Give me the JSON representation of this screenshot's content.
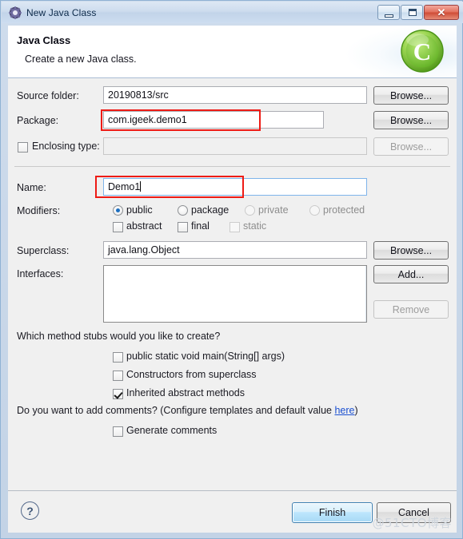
{
  "window": {
    "title": "New Java Class",
    "icon": "gear-icon",
    "controls": {
      "minimize": "─",
      "maximize": "□",
      "close": "✕"
    }
  },
  "header": {
    "title": "Java Class",
    "subtitle": "Create a new Java class.",
    "logo_letter": "C"
  },
  "form": {
    "source_folder": {
      "label": "Source folder:",
      "value": "20190813/src",
      "browse": "Browse..."
    },
    "package": {
      "label": "Package:",
      "value": "com.igeek.demo1",
      "browse": "Browse..."
    },
    "enclosing_type": {
      "label": "Enclosing type:",
      "value": "",
      "browse": "Browse...",
      "checked": false
    },
    "name": {
      "label": "Name:",
      "value": "Demo1"
    },
    "modifiers": {
      "label": "Modifiers:",
      "radios": [
        {
          "label": "public",
          "checked": true,
          "disabled": false
        },
        {
          "label": "package",
          "checked": false,
          "disabled": false
        },
        {
          "label": "private",
          "checked": false,
          "disabled": true
        },
        {
          "label": "protected",
          "checked": false,
          "disabled": true
        }
      ],
      "checkboxes": [
        {
          "label": "abstract",
          "checked": false,
          "disabled": false
        },
        {
          "label": "final",
          "checked": false,
          "disabled": false
        },
        {
          "label": "static",
          "checked": false,
          "disabled": true
        }
      ]
    },
    "superclass": {
      "label": "Superclass:",
      "value": "java.lang.Object",
      "browse": "Browse..."
    },
    "interfaces": {
      "label": "Interfaces:",
      "items": [],
      "add": "Add...",
      "remove": "Remove"
    },
    "stubs": {
      "question": "Which method stubs would you like to create?",
      "options": [
        {
          "label": "public static void main(String[] args)",
          "checked": false
        },
        {
          "label": "Constructors from superclass",
          "checked": false
        },
        {
          "label": "Inherited abstract methods",
          "checked": true
        }
      ]
    },
    "comments": {
      "question_prefix": "Do you want to add comments? (Configure templates and default value ",
      "link": "here",
      "question_suffix": ")",
      "option": {
        "label": "Generate comments",
        "checked": false
      }
    }
  },
  "footer": {
    "help": "?",
    "finish": "Finish",
    "cancel": "Cancel"
  },
  "watermark": "@51CTO博客",
  "colors": {
    "annotation": "#ee1b15",
    "link": "#1a4fd0",
    "accent": "#3c7fb1",
    "logo_green": "#7ac943"
  }
}
